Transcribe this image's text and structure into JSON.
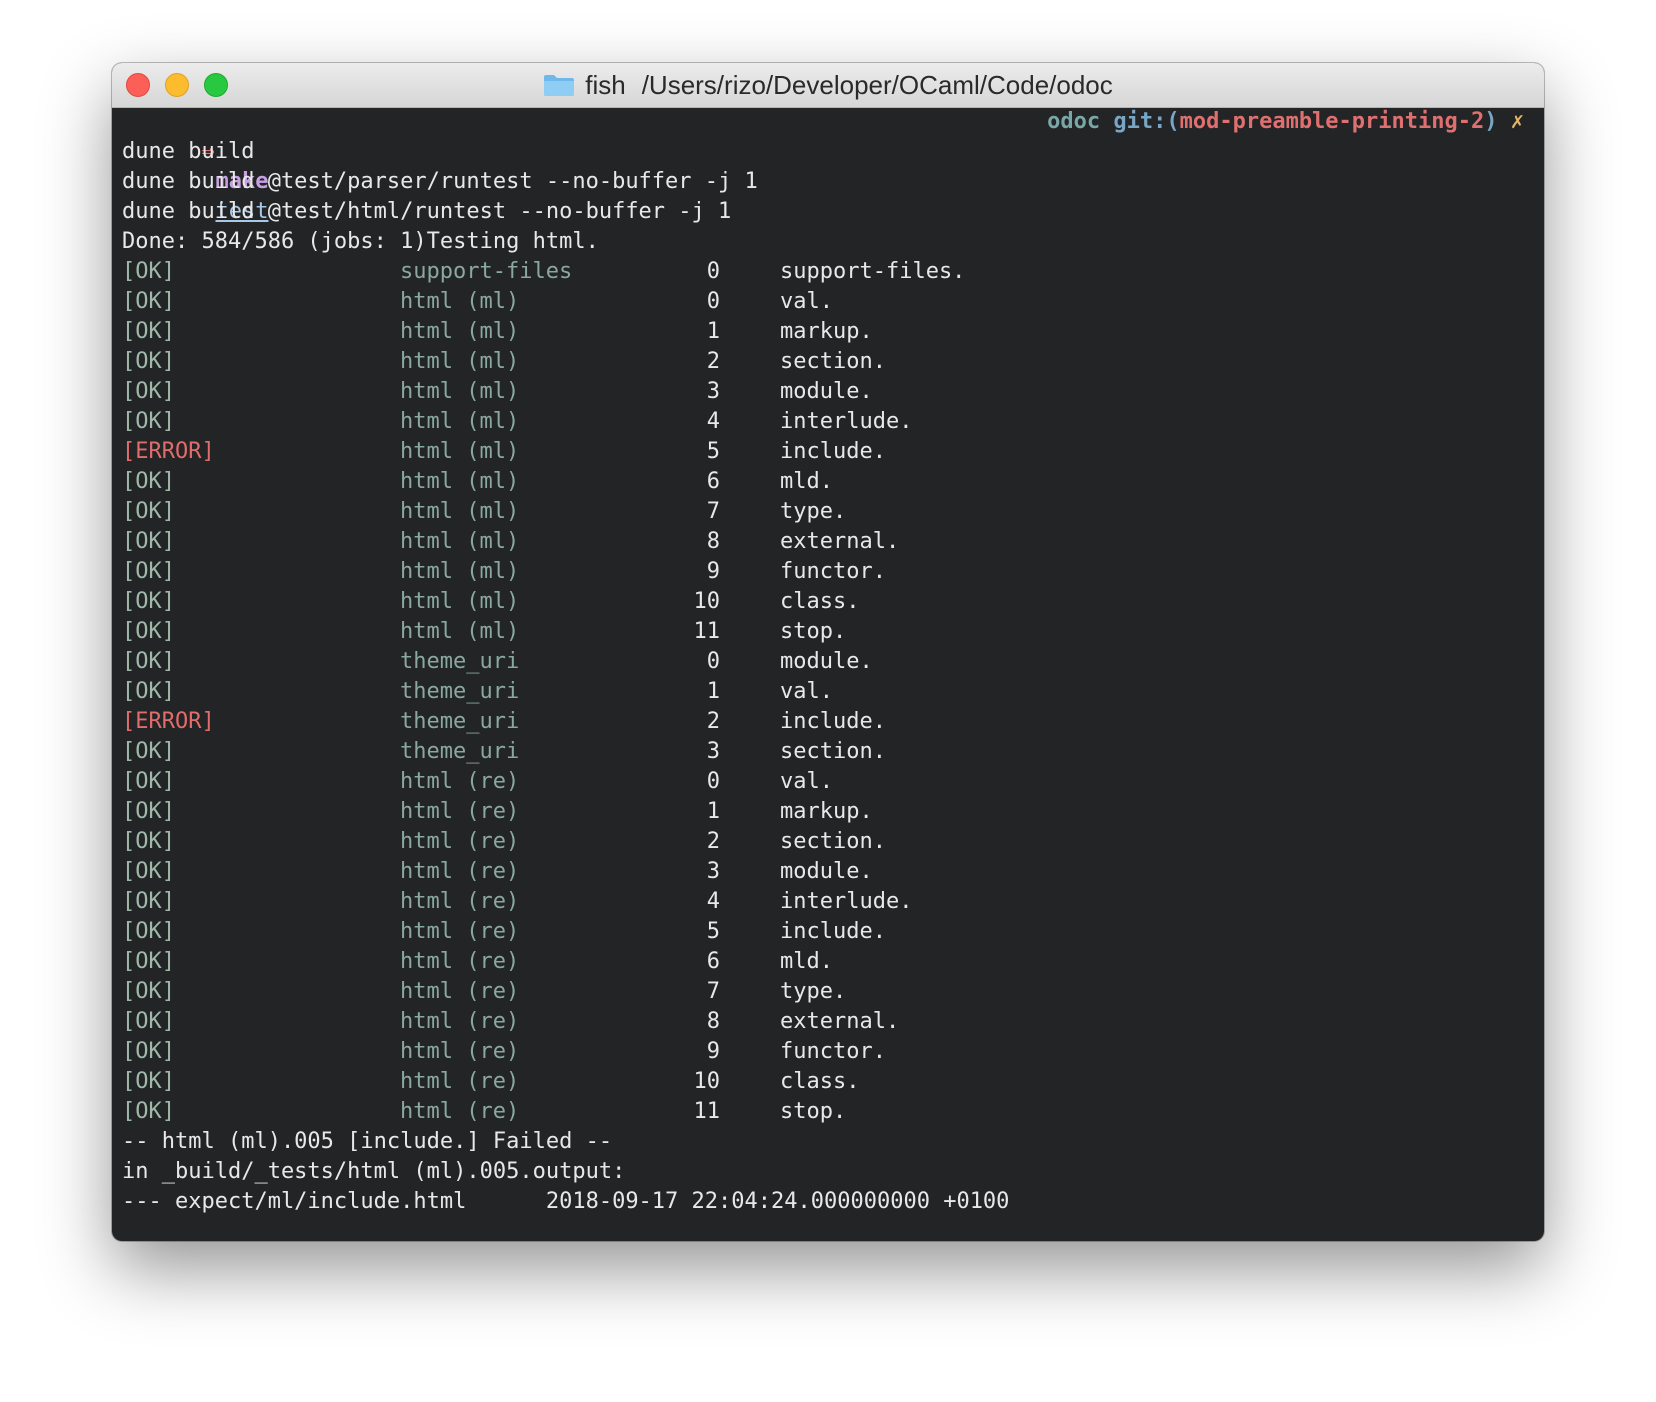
{
  "window": {
    "app": "fish",
    "path": "/Users/rizo/Developer/OCaml/Code/odoc"
  },
  "prompt": {
    "arrow": "⇒",
    "command": "make",
    "argument": "test",
    "dir": "odoc",
    "git_label": "git:(",
    "branch": "mod-preamble-printing-2",
    "git_close": ")",
    "dirty_mark": "✗"
  },
  "output_head": [
    "dune build",
    "dune build @test/parser/runtest --no-buffer -j 1",
    "dune build @test/html/runtest --no-buffer -j 1",
    "Done: 584/586 (jobs: 1)Testing html."
  ],
  "test_rows": [
    {
      "status": "[OK]",
      "kind": "ok",
      "name": "support-files",
      "index": "0",
      "test": "support-files."
    },
    {
      "status": "[OK]",
      "kind": "ok",
      "name": "html (ml)",
      "index": "0",
      "test": "val."
    },
    {
      "status": "[OK]",
      "kind": "ok",
      "name": "html (ml)",
      "index": "1",
      "test": "markup."
    },
    {
      "status": "[OK]",
      "kind": "ok",
      "name": "html (ml)",
      "index": "2",
      "test": "section."
    },
    {
      "status": "[OK]",
      "kind": "ok",
      "name": "html (ml)",
      "index": "3",
      "test": "module."
    },
    {
      "status": "[OK]",
      "kind": "ok",
      "name": "html (ml)",
      "index": "4",
      "test": "interlude."
    },
    {
      "status": "[ERROR]",
      "kind": "error",
      "name": "html (ml)",
      "index": "5",
      "test": "include."
    },
    {
      "status": "[OK]",
      "kind": "ok",
      "name": "html (ml)",
      "index": "6",
      "test": "mld."
    },
    {
      "status": "[OK]",
      "kind": "ok",
      "name": "html (ml)",
      "index": "7",
      "test": "type."
    },
    {
      "status": "[OK]",
      "kind": "ok",
      "name": "html (ml)",
      "index": "8",
      "test": "external."
    },
    {
      "status": "[OK]",
      "kind": "ok",
      "name": "html (ml)",
      "index": "9",
      "test": "functor."
    },
    {
      "status": "[OK]",
      "kind": "ok",
      "name": "html (ml)",
      "index": "10",
      "test": "class."
    },
    {
      "status": "[OK]",
      "kind": "ok",
      "name": "html (ml)",
      "index": "11",
      "test": "stop."
    },
    {
      "status": "[OK]",
      "kind": "ok",
      "name": "theme_uri",
      "index": "0",
      "test": "module."
    },
    {
      "status": "[OK]",
      "kind": "ok",
      "name": "theme_uri",
      "index": "1",
      "test": "val."
    },
    {
      "status": "[ERROR]",
      "kind": "error",
      "name": "theme_uri",
      "index": "2",
      "test": "include."
    },
    {
      "status": "[OK]",
      "kind": "ok",
      "name": "theme_uri",
      "index": "3",
      "test": "section."
    },
    {
      "status": "[OK]",
      "kind": "ok",
      "name": "html (re)",
      "index": "0",
      "test": "val."
    },
    {
      "status": "[OK]",
      "kind": "ok",
      "name": "html (re)",
      "index": "1",
      "test": "markup."
    },
    {
      "status": "[OK]",
      "kind": "ok",
      "name": "html (re)",
      "index": "2",
      "test": "section."
    },
    {
      "status": "[OK]",
      "kind": "ok",
      "name": "html (re)",
      "index": "3",
      "test": "module."
    },
    {
      "status": "[OK]",
      "kind": "ok",
      "name": "html (re)",
      "index": "4",
      "test": "interlude."
    },
    {
      "status": "[OK]",
      "kind": "ok",
      "name": "html (re)",
      "index": "5",
      "test": "include."
    },
    {
      "status": "[OK]",
      "kind": "ok",
      "name": "html (re)",
      "index": "6",
      "test": "mld."
    },
    {
      "status": "[OK]",
      "kind": "ok",
      "name": "html (re)",
      "index": "7",
      "test": "type."
    },
    {
      "status": "[OK]",
      "kind": "ok",
      "name": "html (re)",
      "index": "8",
      "test": "external."
    },
    {
      "status": "[OK]",
      "kind": "ok",
      "name": "html (re)",
      "index": "9",
      "test": "functor."
    },
    {
      "status": "[OK]",
      "kind": "ok",
      "name": "html (re)",
      "index": "10",
      "test": "class."
    },
    {
      "status": "[OK]",
      "kind": "ok",
      "name": "html (re)",
      "index": "11",
      "test": "stop."
    }
  ],
  "output_tail": [
    "-- html (ml).005 [include.] Failed --",
    "in _build/_tests/html (ml).005.output:",
    "--- expect/ml/include.html      2018-09-17 22:04:24.000000000 +0100"
  ],
  "icons": {
    "title_folder": "folder-icon"
  },
  "colors": {
    "terminal_bg": "#222426",
    "ok": "#9fb8aa",
    "error": "#e06c6c",
    "branch": "#e07070",
    "command": "#c6a0e0"
  }
}
